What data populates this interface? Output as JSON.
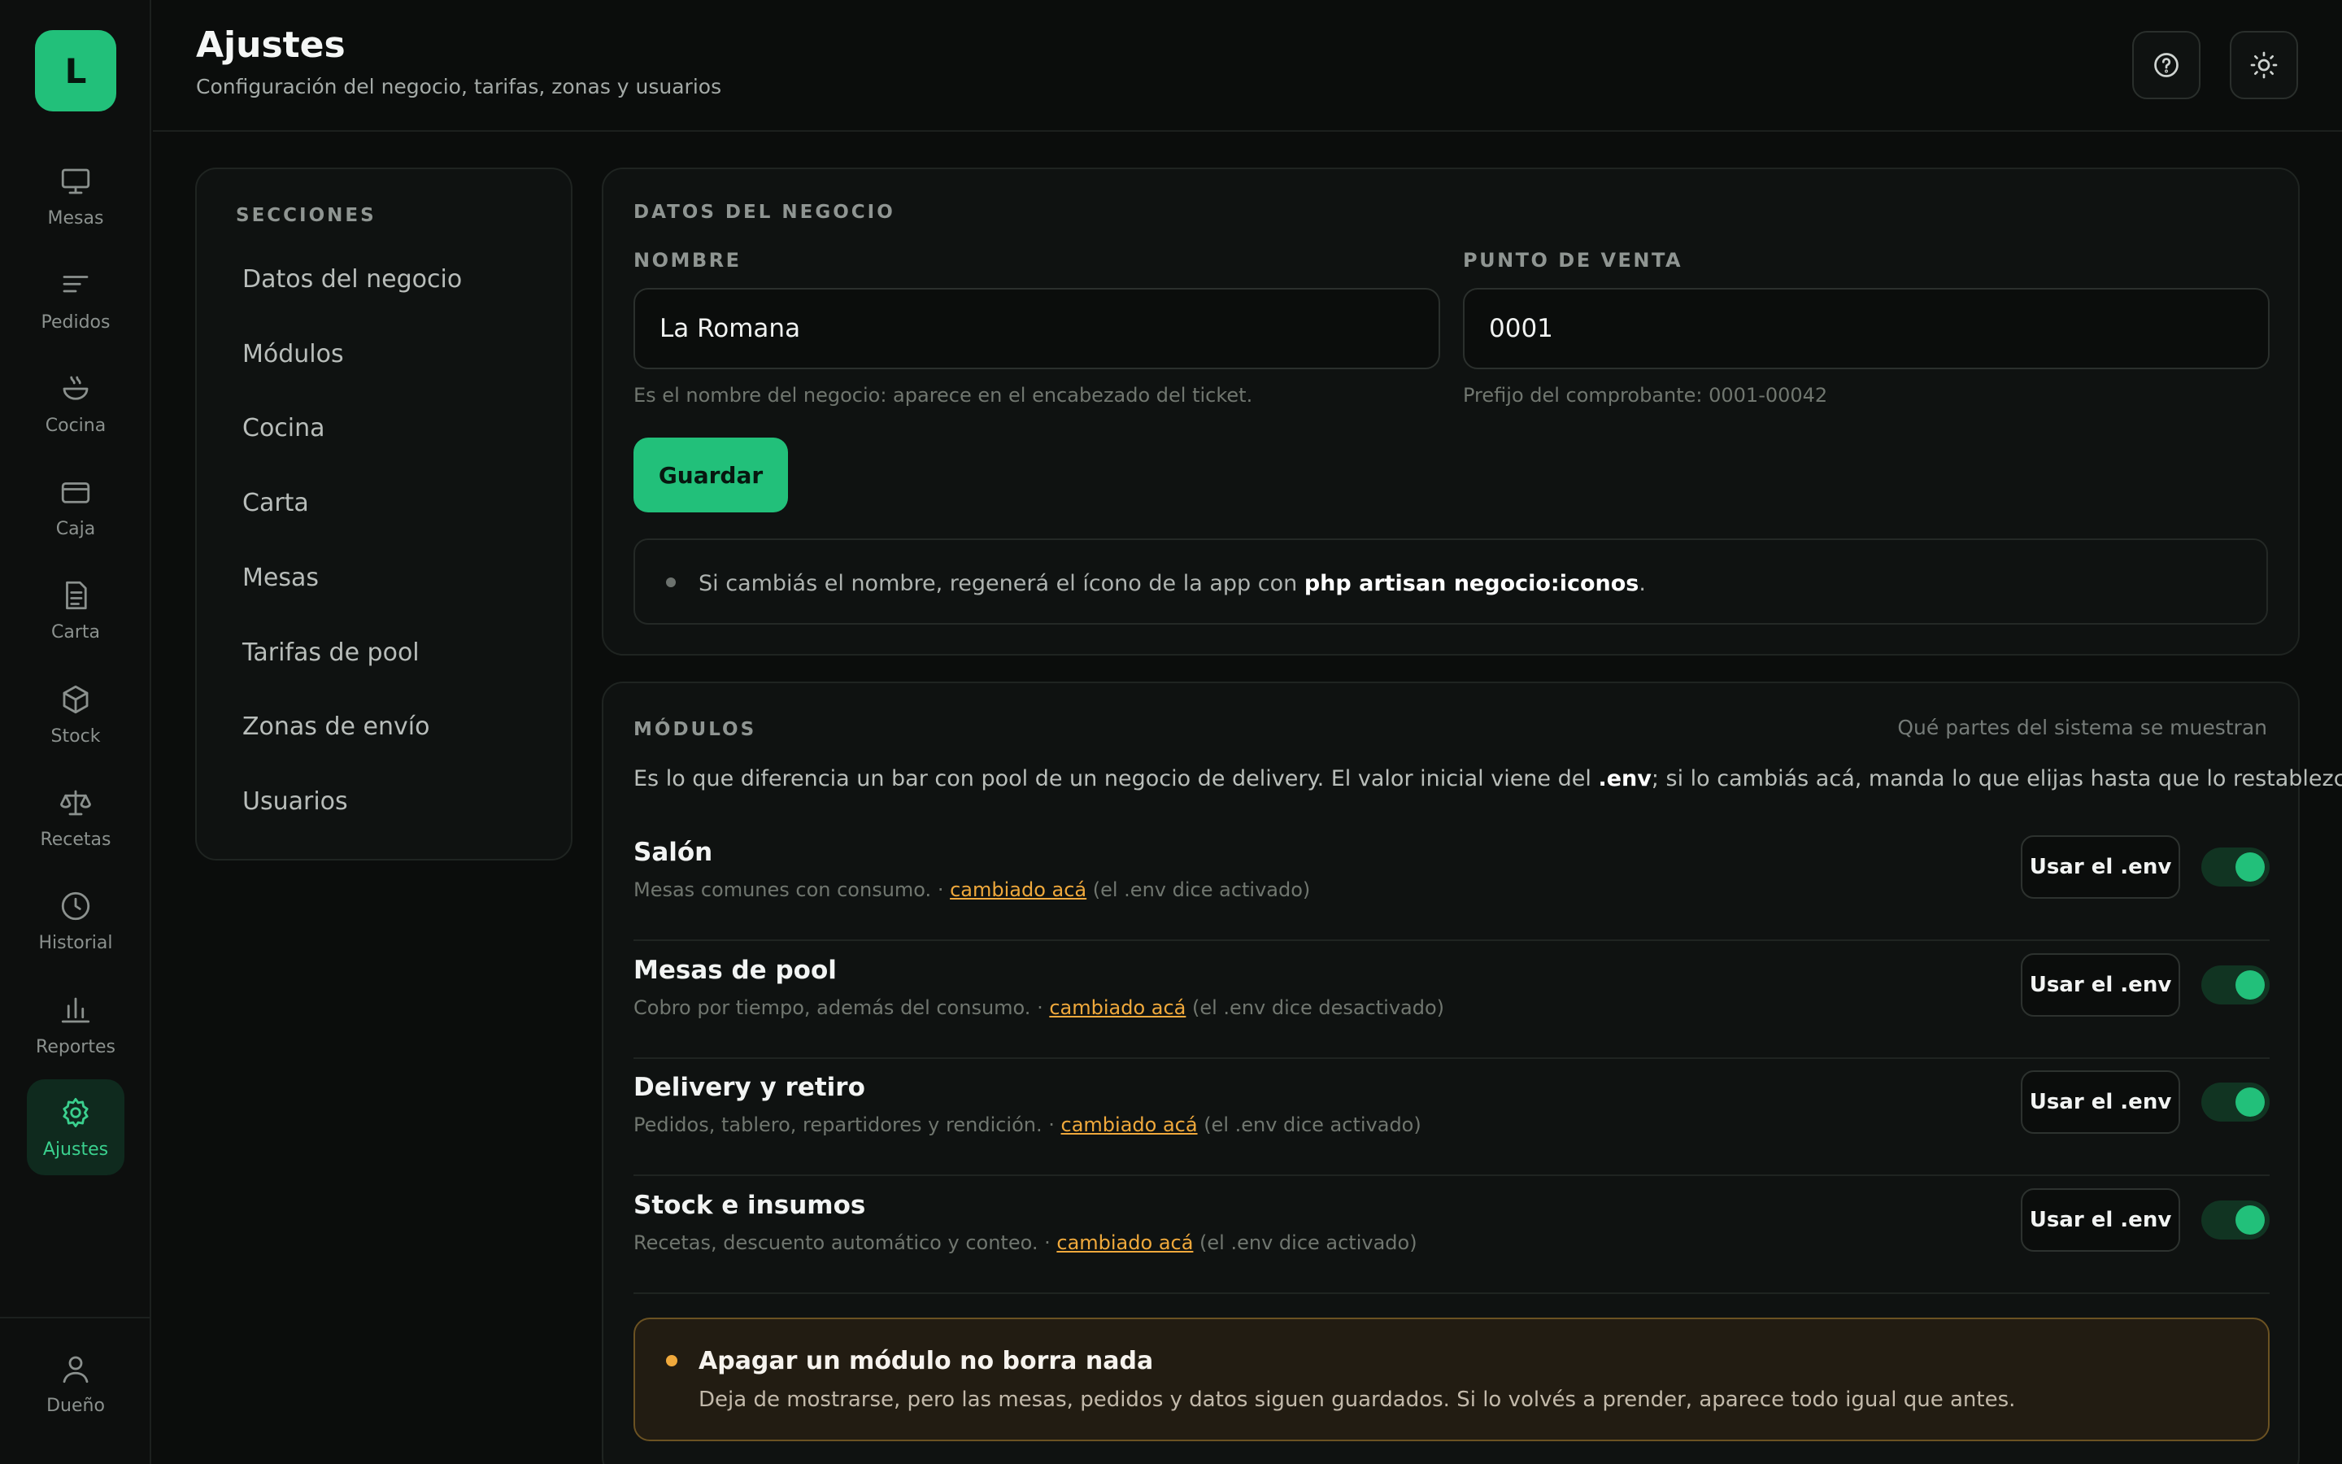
{
  "app": {
    "logo_letter": "L",
    "accent": "#22c07a"
  },
  "sidebar": {
    "items": [
      {
        "label": "Mesas",
        "icon": "monitor-icon"
      },
      {
        "label": "Pedidos",
        "icon": "list-icon"
      },
      {
        "label": "Cocina",
        "icon": "bowl-icon"
      },
      {
        "label": "Caja",
        "icon": "card-icon"
      },
      {
        "label": "Carta",
        "icon": "document-icon"
      },
      {
        "label": "Stock",
        "icon": "box-icon"
      },
      {
        "label": "Recetas",
        "icon": "scale-icon"
      },
      {
        "label": "Historial",
        "icon": "clock-icon"
      },
      {
        "label": "Reportes",
        "icon": "bar-chart-icon"
      },
      {
        "label": "Ajustes",
        "icon": "gear-icon",
        "active": true
      }
    ],
    "user": {
      "label": "Dueño",
      "icon": "user-icon"
    }
  },
  "header": {
    "title": "Ajustes",
    "subtitle": "Configuración del negocio, tarifas, zonas y usuarios"
  },
  "sections": {
    "title": "SECCIONES",
    "items": [
      "Datos del negocio",
      "Módulos",
      "Cocina",
      "Carta",
      "Mesas",
      "Tarifas de pool",
      "Zonas de envío",
      "Usuarios"
    ]
  },
  "business": {
    "title": "DATOS DEL NEGOCIO",
    "name_label": "NOMBRE",
    "name_value": "La Romana",
    "name_help": "Es el nombre del negocio: aparece en el encabezado del ticket.",
    "pos_label": "PUNTO DE VENTA",
    "pos_value": "0001",
    "pos_help": "Prefijo del comprobante: 0001-00042",
    "save_label": "Guardar",
    "note_prefix": "Si cambiás el nombre, regenerá el ícono de la app con ",
    "note_command": "php artisan negocio:iconos",
    "note_suffix": "."
  },
  "modules": {
    "title": "MÓDULOS",
    "aside": "Qué partes del sistema se muestran",
    "desc_prefix": "Es lo que diferencia un bar con pool de un negocio de delivery. El valor inicial viene del ",
    "desc_env": ".env",
    "desc_suffix": "; si lo cambiás acá, manda lo que elijas hasta que lo restablezcas.",
    "env_button_label": "Usar el .env",
    "items": [
      {
        "name": "Salón",
        "desc": "Mesas comunes con consumo. · ",
        "changed": "cambiado acá",
        "env_note": " (el .env dice activado)",
        "enabled": true
      },
      {
        "name": "Mesas de pool",
        "desc": "Cobro por tiempo, además del consumo. · ",
        "changed": "cambiado acá",
        "env_note": " (el .env dice desactivado)",
        "enabled": true
      },
      {
        "name": "Delivery y retiro",
        "desc": "Pedidos, tablero, repartidores y rendición. · ",
        "changed": "cambiado acá",
        "env_note": " (el .env dice activado)",
        "enabled": true
      },
      {
        "name": "Stock e insumos",
        "desc": "Recetas, descuento automático y conteo. · ",
        "changed": "cambiado acá",
        "env_note": " (el .env dice activado)",
        "enabled": true
      }
    ],
    "warning_title": "Apagar un módulo no borra nada",
    "warning_text": "Deja de mostrarse, pero las mesas, pedidos y datos siguen guardados. Si lo volvés a prender, aparece todo igual que antes."
  }
}
